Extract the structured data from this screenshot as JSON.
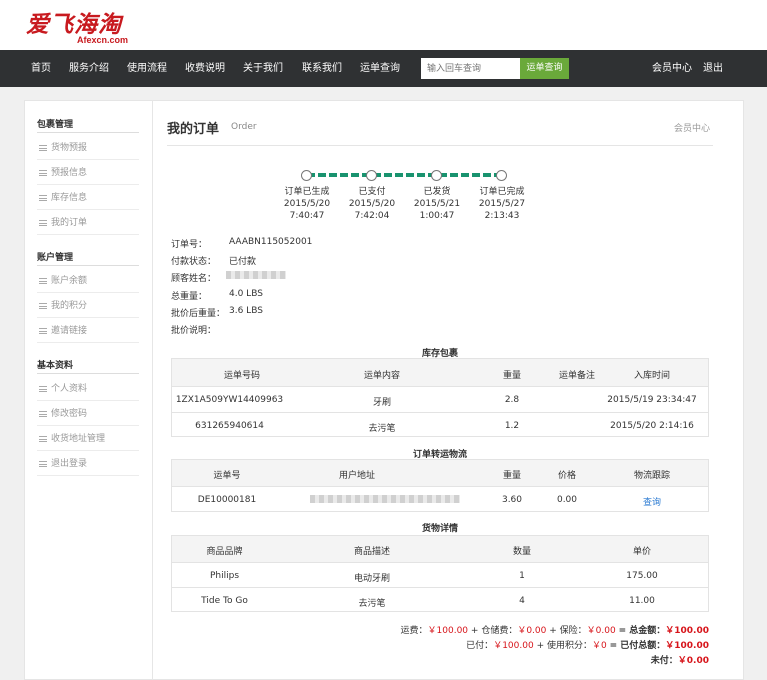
{
  "logo": {
    "cn": "爱飞海淘",
    "en": "Afexcn.com"
  },
  "nav": {
    "items": [
      "首页",
      "服务介绍",
      "使用流程",
      "收费说明",
      "关于我们",
      "联系我们",
      "运单查询"
    ],
    "search_placeholder": "输入回车查询",
    "search_button": "运单查询",
    "member_center": "会员中心",
    "logout": "退出"
  },
  "sidebar": {
    "groups": [
      {
        "title": "包裹管理",
        "items": [
          "货物预报",
          "预报信息",
          "库存信息",
          "我的订单"
        ]
      },
      {
        "title": "账户管理",
        "items": [
          "账户余额",
          "我的积分",
          "邀请链接"
        ]
      },
      {
        "title": "基本资料",
        "items": [
          "个人资料",
          "修改密码",
          "收货地址管理",
          "退出登录"
        ]
      }
    ]
  },
  "page": {
    "title": "我的订单",
    "subtitle": "Order",
    "right_link": "会员中心"
  },
  "timeline": [
    {
      "label": "订单已生成",
      "date": "2015/5/20",
      "time": "7:40:47"
    },
    {
      "label": "已支付",
      "date": "2015/5/20",
      "time": "7:42:04"
    },
    {
      "label": "已发货",
      "date": "2015/5/21",
      "time": "1:00:47"
    },
    {
      "label": "订单已完成",
      "date": "2015/5/27",
      "time": "2:13:43"
    }
  ],
  "info": {
    "order_no_label": "订单号：",
    "order_no": "AAABN115052001",
    "pay_status_label": "付款状态：",
    "pay_status": "已付款",
    "customer_label": "顾客姓名：",
    "total_weight_label": "总重量：",
    "total_weight": "4.0 LBS",
    "after_weight_label": "批价后重量：",
    "after_weight": "3.6 LBS",
    "note_label": "批价说明："
  },
  "inventory": {
    "title": "库存包裹",
    "headers": [
      "运单号码",
      "运单内容",
      "重量",
      "运单备注",
      "入库时间"
    ],
    "rows": [
      [
        "1ZX1A509YW14409963",
        "牙刷",
        "2.8",
        "",
        "2015/5/19 23:34:47"
      ],
      [
        "631265940614",
        "去污笔",
        "1.2",
        "",
        "2015/5/20 2:14:16"
      ]
    ]
  },
  "transfer": {
    "title": "订单转运物流",
    "headers": [
      "运单号",
      "用户地址",
      "重量",
      "价格",
      "物流跟踪"
    ],
    "rows": [
      [
        "DE10000181",
        "",
        "3.60",
        "0.00",
        "查询"
      ]
    ]
  },
  "goods": {
    "title": "货物详情",
    "headers": [
      "商品品牌",
      "商品描述",
      "数量",
      "单价"
    ],
    "rows": [
      [
        "Philips",
        "电动牙刷",
        "1",
        "175.00"
      ],
      [
        "Tide To Go",
        "去污笔",
        "4",
        "11.00"
      ]
    ]
  },
  "summary": {
    "freight_label": "运费：",
    "freight": "￥100.00",
    "storage_label": "+ 仓储费：",
    "storage": "￥0.00",
    "insurance_label": "+ 保险：",
    "insurance": "￥0.00",
    "total_label": "= 总金额：",
    "total": "￥100.00",
    "paid_label": "已付：",
    "paid": "￥100.00",
    "points_label": "+ 使用积分：",
    "points": "￥0",
    "paid_total_label": "= 已付总额：",
    "paid_total": "￥100.00",
    "unpaid_label": "未付：",
    "unpaid": "￥0.00"
  },
  "colors": {
    "nav_bg": "#2f3133",
    "accent_green": "#6aa93a",
    "progress": "#19936f",
    "money_red": "#d7141a",
    "logo_red": "#c81a1f"
  }
}
